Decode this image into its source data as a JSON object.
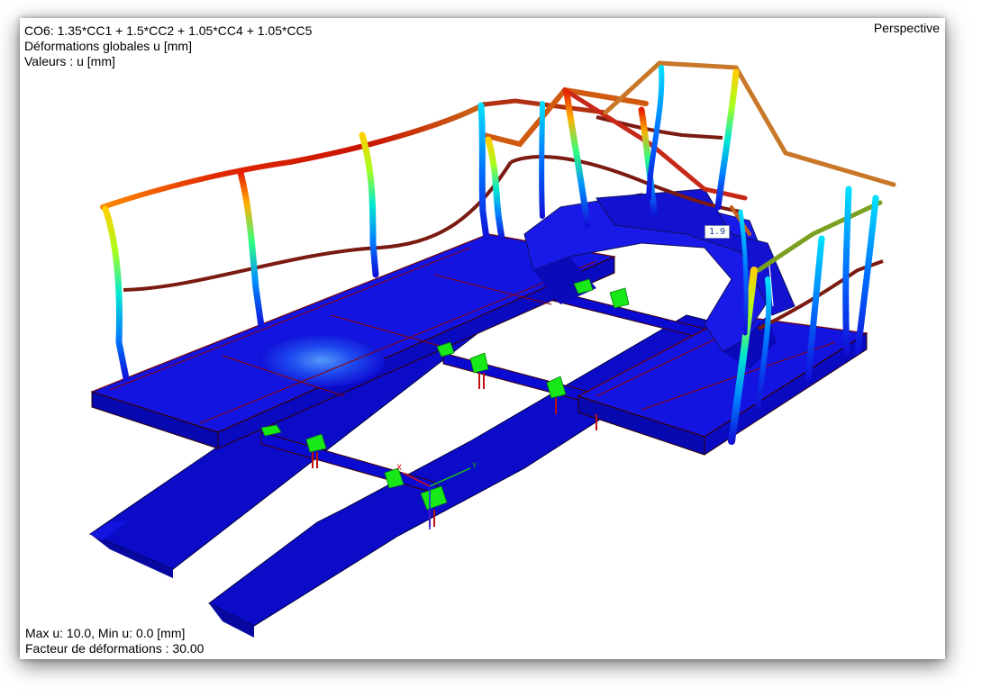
{
  "viewport": {
    "header": {
      "combination": "CO6: 1.35*CC1 + 1.5*CC2 + 1.05*CC4 + 1.05*CC5",
      "result_type": "Déformations globales u [mm]",
      "values_label": "Valeurs : u [mm]"
    },
    "projection": "Perspective",
    "footer": {
      "range": "Max u: 10.0, Min u: 0.0 [mm]",
      "factor": "Facteur de déformations : 30.00"
    },
    "value_tag": "1.9",
    "axes": {
      "y_label": "Y",
      "x_label": "X"
    }
  },
  "colors": {
    "structure_blue": "#1010d8",
    "support_green": "#18e818",
    "max_red": "#d01000",
    "edge_red": "#8b0000"
  }
}
